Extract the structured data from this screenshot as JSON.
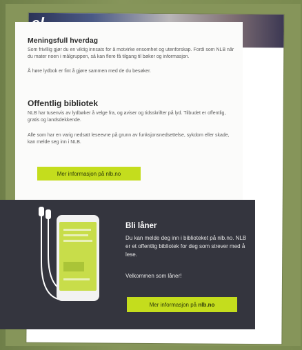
{
  "flyer": {
    "logo_fragment": "el",
    "section1": {
      "title": "Meningsfull hverdag",
      "body": "Som frivillig gjør du en viktig innsats for å motvirke ensomhet og utenforskap. Fordi som NLB når du mater noen i målgruppen, så kan flere få tilgang til bøker og informasjon.",
      "extra": "Å høre lydbok er fint å gjøre sammen med de du besøker."
    },
    "section2": {
      "title": "Offentlig bibliotek",
      "body": "NLB har tusenvis av lydbøker å velge fra, og aviser og tidsskrifter på lyd. Tilbudet er offentlig, gratis og landsdekkende.",
      "extra": "Alle som har en varig nedsatt leseevne på grunn av funksjonsnedsettelse, sykdom eller skade, kan melde seg inn i NLB."
    },
    "button1": "Mer informasjon på nlb.no",
    "bottom": {
      "title": "Bli låner",
      "body": "Du kan melde deg inn i biblioteket på nlb.no. NLB er et offentlig bibliotek for deg som strever med å lese.",
      "welcome": "Velkommen som låner!",
      "button_prefix": "Mer informasjon på ",
      "button_link": "nlb.no"
    }
  }
}
